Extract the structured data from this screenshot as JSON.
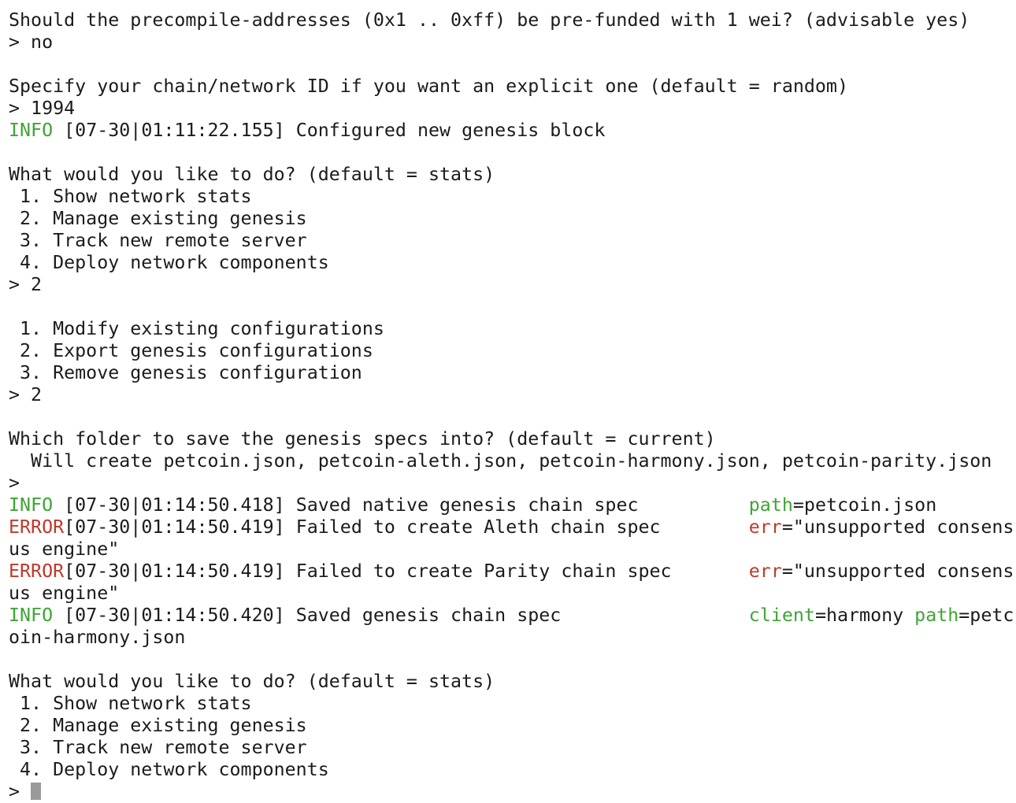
{
  "lines": [
    {
      "type": "text",
      "text": "Should the precompile-addresses (0x1 .. 0xff) be pre-funded with 1 wei? (advisable yes)"
    },
    {
      "type": "text",
      "text": "> no"
    },
    {
      "type": "text",
      "text": ""
    },
    {
      "type": "text",
      "text": "Specify your chain/network ID if you want an explicit one (default = random)"
    },
    {
      "type": "text",
      "text": "> 1994"
    },
    {
      "type": "log",
      "level": "INFO ",
      "level_class": "info",
      "time": "[07-30|01:11:22.155]",
      "message": " Configured new genesis block",
      "pad": "",
      "kv": []
    },
    {
      "type": "text",
      "text": ""
    },
    {
      "type": "text",
      "text": "What would you like to do? (default = stats)"
    },
    {
      "type": "text",
      "text": " 1. Show network stats"
    },
    {
      "type": "text",
      "text": " 2. Manage existing genesis"
    },
    {
      "type": "text",
      "text": " 3. Track new remote server"
    },
    {
      "type": "text",
      "text": " 4. Deploy network components"
    },
    {
      "type": "text",
      "text": "> 2"
    },
    {
      "type": "text",
      "text": ""
    },
    {
      "type": "text",
      "text": " 1. Modify existing configurations"
    },
    {
      "type": "text",
      "text": " 2. Export genesis configurations"
    },
    {
      "type": "text",
      "text": " 3. Remove genesis configuration"
    },
    {
      "type": "text",
      "text": "> 2"
    },
    {
      "type": "text",
      "text": ""
    },
    {
      "type": "text",
      "text": "Which folder to save the genesis specs into? (default = current)"
    },
    {
      "type": "text",
      "text": "  Will create petcoin.json, petcoin-aleth.json, petcoin-harmony.json, petcoin-parity.json"
    },
    {
      "type": "text",
      "text": ">"
    },
    {
      "type": "log",
      "level": "INFO ",
      "level_class": "info",
      "time": "[07-30|01:14:50.418]",
      "message": " Saved native genesis chain spec",
      "pad": "          ",
      "kv": [
        {
          "key": "path",
          "key_class": "key-green",
          "value": "=petcoin.json"
        }
      ]
    },
    {
      "type": "log",
      "level": "ERROR",
      "level_class": "error",
      "time": "[07-30|01:14:50.419]",
      "message": " Failed to create Aleth chain spec",
      "pad": "        ",
      "kv": [
        {
          "key": "err",
          "key_class": "key-red",
          "value": "=\"unsupported consens"
        }
      ]
    },
    {
      "type": "text",
      "text": "us engine\""
    },
    {
      "type": "log",
      "level": "ERROR",
      "level_class": "error",
      "time": "[07-30|01:14:50.419]",
      "message": " Failed to create Parity chain spec",
      "pad": "       ",
      "kv": [
        {
          "key": "err",
          "key_class": "key-red",
          "value": "=\"unsupported consens"
        }
      ]
    },
    {
      "type": "text",
      "text": "us engine\""
    },
    {
      "type": "log",
      "level": "INFO ",
      "level_class": "info",
      "time": "[07-30|01:14:50.420]",
      "message": " Saved genesis chain spec",
      "pad": "                 ",
      "kv": [
        {
          "key": "client",
          "key_class": "key-green",
          "value": "=harmony "
        },
        {
          "key": "path",
          "key_class": "key-green",
          "value": "=petc"
        }
      ]
    },
    {
      "type": "text",
      "text": "oin-harmony.json"
    },
    {
      "type": "text",
      "text": ""
    },
    {
      "type": "text",
      "text": "What would you like to do? (default = stats)"
    },
    {
      "type": "text",
      "text": " 1. Show network stats"
    },
    {
      "type": "text",
      "text": " 2. Manage existing genesis"
    },
    {
      "type": "text",
      "text": " 3. Track new remote server"
    },
    {
      "type": "text",
      "text": " 4. Deploy network components"
    },
    {
      "type": "prompt",
      "text": "> "
    }
  ],
  "colors": {
    "info": "#3fa535",
    "error": "#c0392b",
    "text": "#1b1b1b",
    "cursor": "#9a9a9a"
  }
}
